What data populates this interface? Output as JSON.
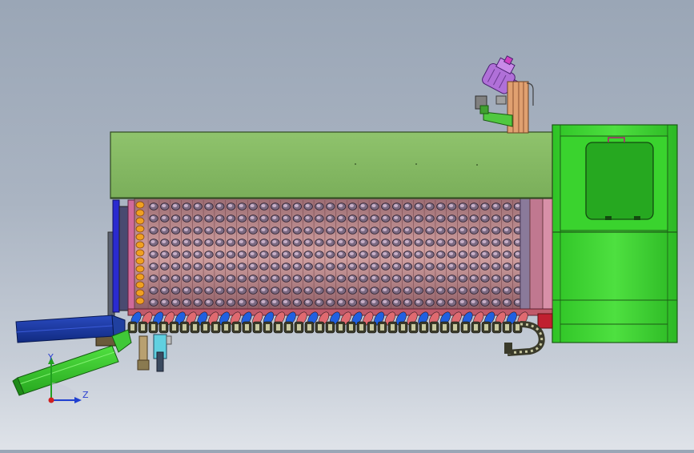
{
  "viewport": {
    "name": "cad-graphics-area",
    "colors": {
      "background_top": "#9aa6b6",
      "background_bottom": "#dfe3e9",
      "cover_green": "#8cc06a",
      "housing_green": "#3fd234",
      "drum_pink": "#c89898",
      "blue_tube": "#1a3aa8",
      "chain_dark": "#3a3a2a",
      "motor_purple": "#b070d8"
    }
  },
  "triad": {
    "y_label": "Y",
    "z_label": "Z",
    "x_color": "#d02020",
    "y_color": "#20a020",
    "z_color": "#2040d0",
    "icon": "coordinate-triad-icon"
  },
  "model": {
    "components": [
      "top-cover",
      "drum-grid",
      "right-housing",
      "inspection-window",
      "screw-conveyor",
      "drag-chain",
      "blue-inlet-tube",
      "green-inlet-tube",
      "motor-assembly",
      "left-frame"
    ]
  }
}
